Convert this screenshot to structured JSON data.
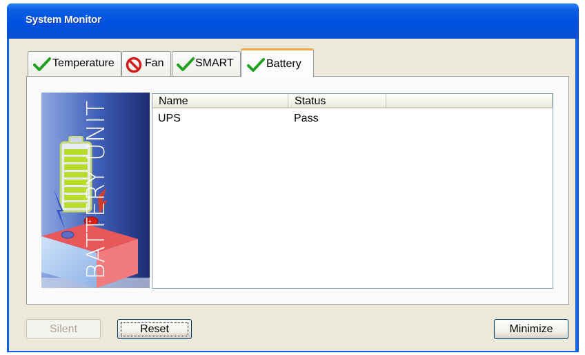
{
  "window": {
    "title": "System Monitor"
  },
  "tabs": [
    {
      "label": "Temperature",
      "icon": "check-icon",
      "active": false
    },
    {
      "label": "Fan",
      "icon": "prohibited-icon",
      "active": false
    },
    {
      "label": "SMART",
      "icon": "check-icon",
      "active": false
    },
    {
      "label": "Battery",
      "icon": "check-icon",
      "active": true
    }
  ],
  "battery_panel": {
    "image_text": "BATTERY UNIT",
    "list": {
      "columns": [
        "Name",
        "Status",
        ""
      ],
      "rows": [
        {
          "name": "UPS",
          "status": "Pass"
        }
      ]
    }
  },
  "buttons": {
    "silent": "Silent",
    "reset": "Reset",
    "minimize": "Minimize"
  },
  "colors": {
    "titlebar": "#0a5fe4",
    "active_tab_accent": "#f3a84a",
    "check_green": "#21a121",
    "prohibited_red": "#d11a1a"
  }
}
